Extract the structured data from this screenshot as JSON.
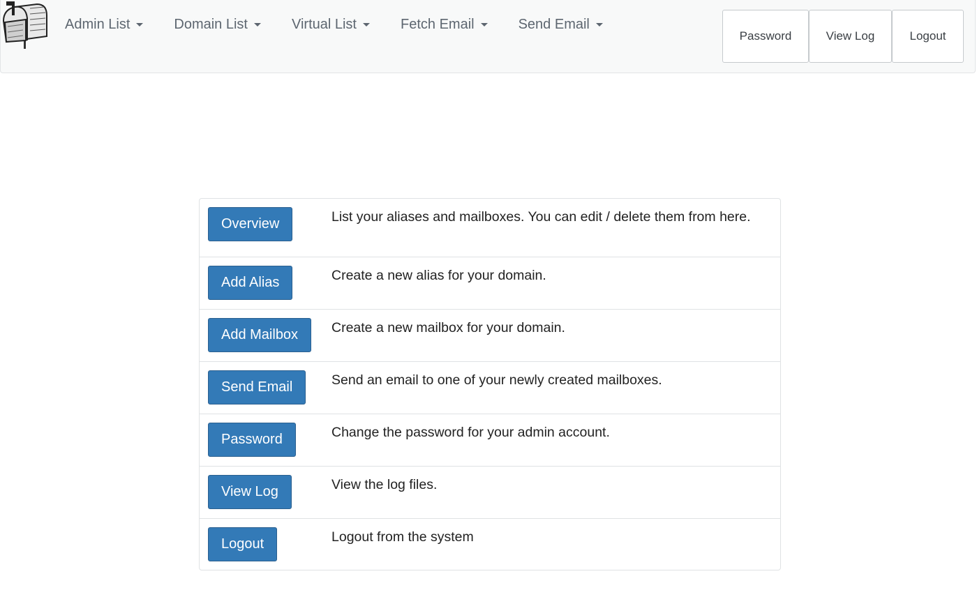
{
  "header": {
    "menu": [
      {
        "label": "Admin List"
      },
      {
        "label": "Domain List"
      },
      {
        "label": "Virtual List"
      },
      {
        "label": "Fetch Email"
      },
      {
        "label": "Send Email"
      }
    ],
    "buttons": [
      {
        "label": "Password"
      },
      {
        "label": "View Log"
      },
      {
        "label": "Logout"
      }
    ]
  },
  "main": {
    "rows": [
      {
        "button": "Overview",
        "description": "List your aliases and mailboxes. You can edit / delete them from here."
      },
      {
        "button": "Add Alias",
        "description": "Create a new alias for your domain."
      },
      {
        "button": "Add Mailbox",
        "description": "Create a new mailbox for your domain."
      },
      {
        "button": "Send Email",
        "description": "Send an email to one of your newly created mailboxes."
      },
      {
        "button": "Password",
        "description": "Change the password for your admin account."
      },
      {
        "button": "View Log",
        "description": "View the log files."
      },
      {
        "button": "Logout",
        "description": "Logout from the system"
      }
    ]
  },
  "colors": {
    "primary": "#337ab7",
    "navbar_bg": "#f8f9f9",
    "nav_text": "#5d6670"
  },
  "icons": {
    "logo": "mailbox-icon"
  }
}
